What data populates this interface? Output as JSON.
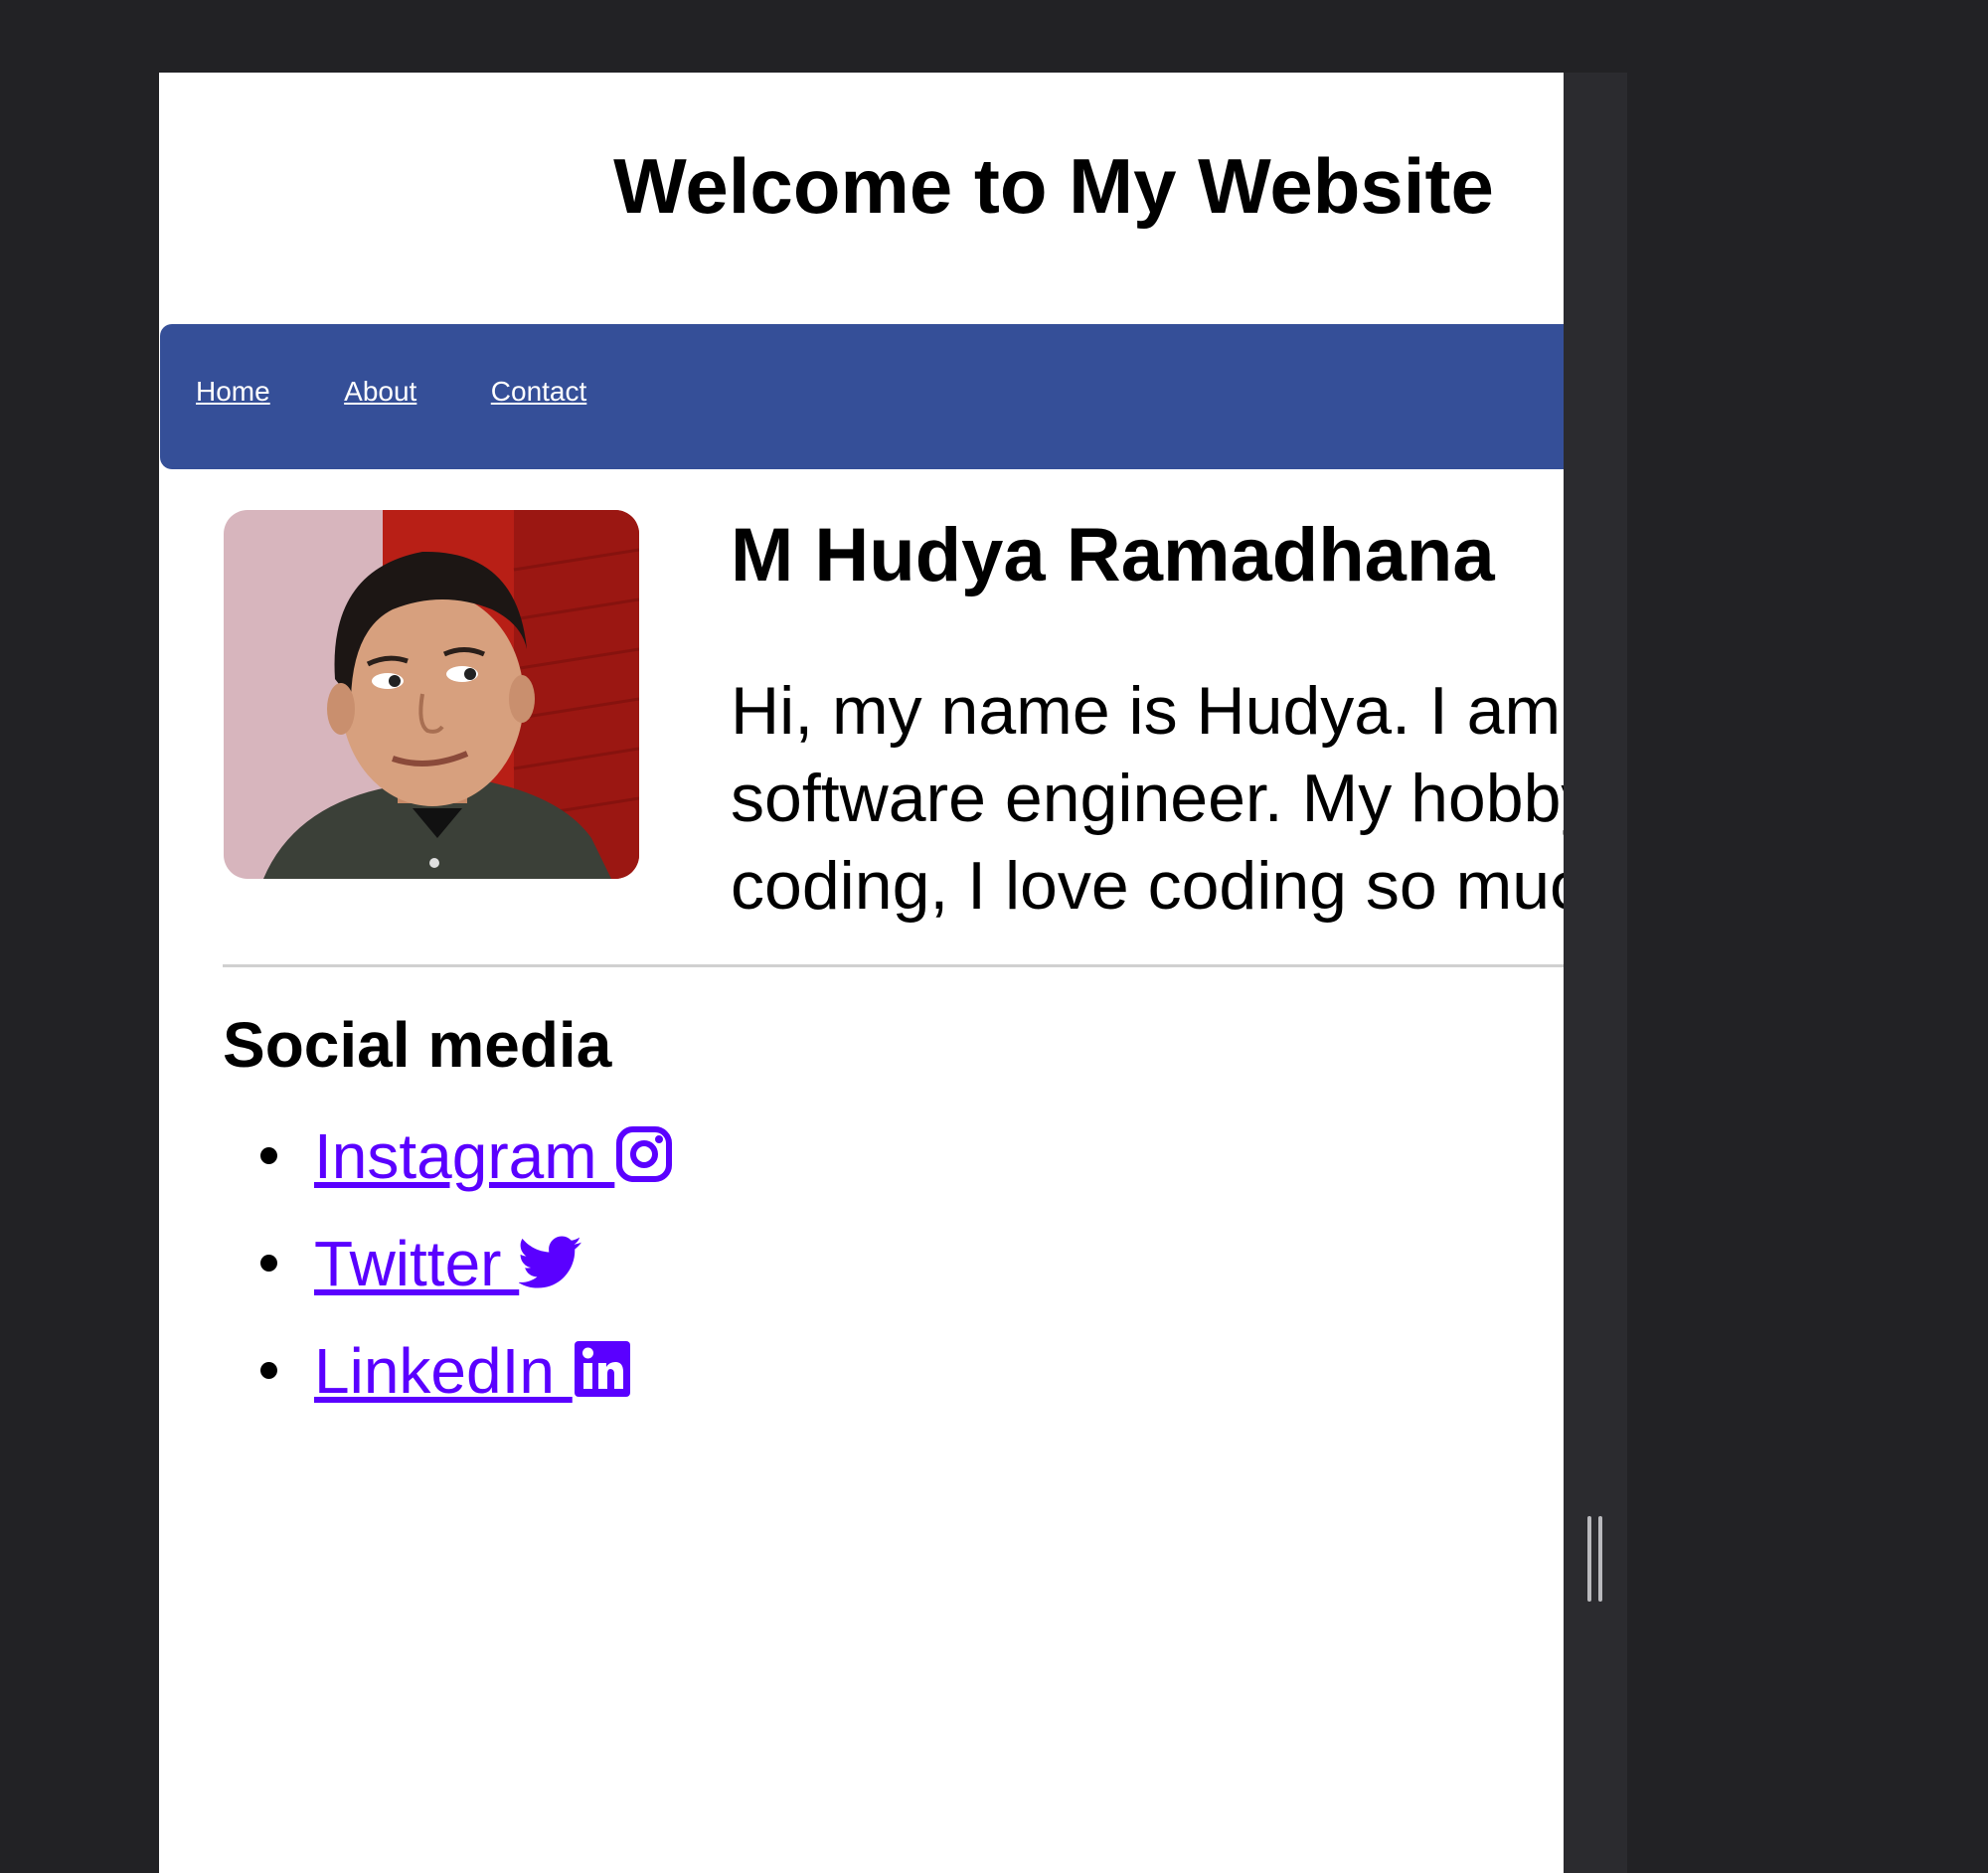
{
  "page": {
    "title": "Welcome to My Website"
  },
  "nav": {
    "items": [
      {
        "label": "Home"
      },
      {
        "label": "About"
      },
      {
        "label": "Contact"
      }
    ]
  },
  "profile": {
    "name": "M Hudya Ramadhana",
    "bio": "Hi, my name is Hudya. I am a software engineer. My hobby is coding, I love coding so much."
  },
  "social": {
    "heading": "Social media",
    "items": [
      {
        "label": "Instagram ",
        "icon": "instagram-icon"
      },
      {
        "label": "Twitter ",
        "icon": "twitter-icon"
      },
      {
        "label": "LinkedIn ",
        "icon": "linkedin-icon"
      }
    ]
  },
  "colors": {
    "nav_background": "#354f98",
    "link": "#5a00ff",
    "frame": "#222225"
  }
}
